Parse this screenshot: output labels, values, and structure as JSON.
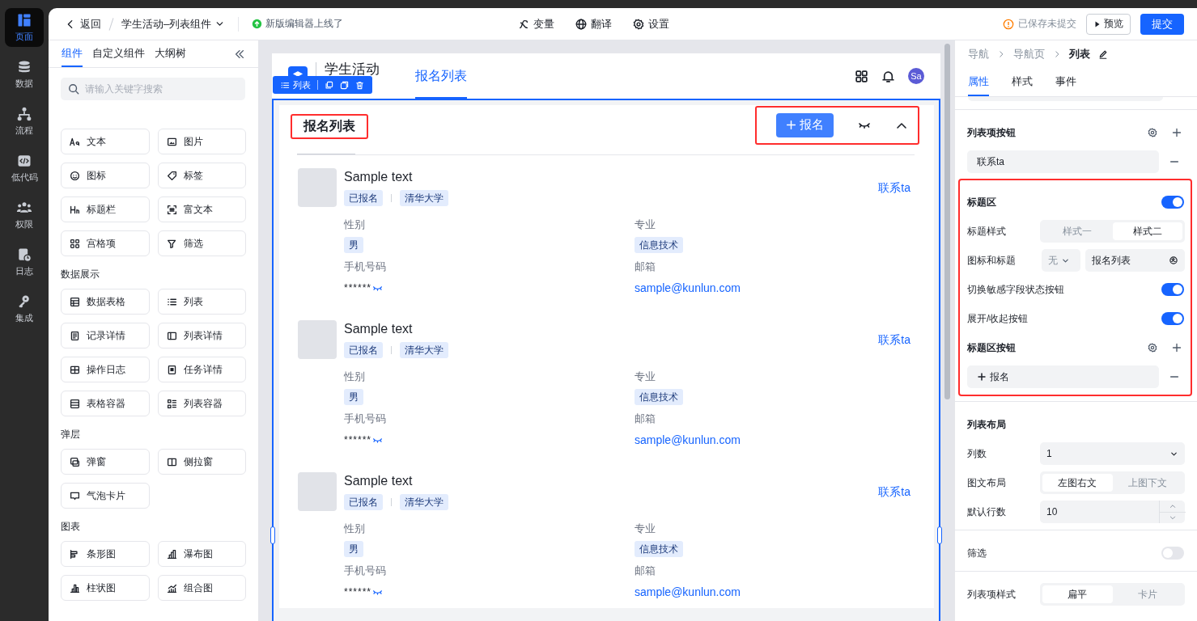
{
  "rail": {
    "items": [
      {
        "label": "页面",
        "selected": true
      },
      {
        "label": "数据",
        "selected": false
      },
      {
        "label": "流程",
        "selected": false
      },
      {
        "label": "低代码",
        "selected": false
      },
      {
        "label": "权限",
        "selected": false
      },
      {
        "label": "日志",
        "selected": false
      },
      {
        "label": "集成",
        "selected": false
      }
    ]
  },
  "topbar": {
    "back": "返回",
    "title": "学生活动–列表组件",
    "notice": "新版编辑器上线了",
    "tools": [
      {
        "label": "变量"
      },
      {
        "label": "翻译"
      },
      {
        "label": "设置"
      }
    ],
    "status": "已保存未提交",
    "preview": "预览",
    "submit": "提交"
  },
  "left_panel": {
    "tabs": [
      {
        "label": "组件",
        "selected": true
      },
      {
        "label": "自定义组件",
        "selected": false
      },
      {
        "label": "大纲树",
        "selected": false
      }
    ],
    "search": {
      "placeholder": "请输入关键字搜索"
    },
    "sections": [
      {
        "items": [
          "文本",
          "图片",
          "图标",
          "标签",
          "标题栏",
          "富文本",
          "宫格项",
          "筛选"
        ]
      },
      {
        "title": "数据展示",
        "items": [
          "数据表格",
          "列表",
          "记录详情",
          "列表详情",
          "操作日志",
          "任务详情",
          "表格容器",
          "列表容器"
        ]
      },
      {
        "title": "弹层",
        "items": [
          "弹窗",
          "侧拉窗",
          "气泡卡片"
        ]
      },
      {
        "title": "图表",
        "items": [
          "条形图",
          "瀑布图",
          "柱状图",
          "组合图"
        ]
      }
    ]
  },
  "canvas": {
    "app_name": "学生活动",
    "nav_tab": {
      "label": "报名列表",
      "selected": true
    },
    "avatar": "Sa",
    "toolbar_label": "列表",
    "list": {
      "title": "报名列表",
      "add_button": "报名",
      "items": [
        {
          "title": "Sample text",
          "tags": [
            "已报名",
            "清华大学"
          ],
          "action": "联系ta",
          "fields": [
            {
              "label": "性别",
              "value": "男",
              "kind": "tag"
            },
            {
              "label": "专业",
              "value": "信息技术",
              "kind": "tag"
            },
            {
              "label": "手机号码",
              "value": "******",
              "kind": "masked"
            },
            {
              "label": "邮箱",
              "value": "sample@kunlun.com",
              "kind": "link"
            }
          ]
        },
        {
          "title": "Sample text",
          "tags": [
            "已报名",
            "清华大学"
          ],
          "action": "联系ta",
          "fields": [
            {
              "label": "性别",
              "value": "男",
              "kind": "tag"
            },
            {
              "label": "专业",
              "value": "信息技术",
              "kind": "tag"
            },
            {
              "label": "手机号码",
              "value": "******",
              "kind": "masked"
            },
            {
              "label": "邮箱",
              "value": "sample@kunlun.com",
              "kind": "link"
            }
          ]
        },
        {
          "title": "Sample text",
          "tags": [
            "已报名",
            "清华大学"
          ],
          "action": "联系ta",
          "fields": [
            {
              "label": "性别",
              "value": "男",
              "kind": "tag"
            },
            {
              "label": "专业",
              "value": "信息技术",
              "kind": "tag"
            },
            {
              "label": "手机号码",
              "value": "******",
              "kind": "masked"
            },
            {
              "label": "邮箱",
              "value": "sample@kunlun.com",
              "kind": "link"
            }
          ]
        }
      ]
    }
  },
  "right_panel": {
    "breadcrumb": [
      "导航",
      "导航页",
      "列表"
    ],
    "tabs": [
      {
        "label": "属性",
        "selected": true
      },
      {
        "label": "样式",
        "selected": false
      },
      {
        "label": "事件",
        "selected": false
      }
    ],
    "sections": [
      {
        "highlighted": false,
        "rows": [
          {
            "kind": "heading_tools",
            "label": "列表项按钮"
          },
          {
            "kind": "item",
            "value": "联系ta",
            "plus": false
          }
        ]
      },
      {
        "highlighted": true,
        "rows": [
          {
            "kind": "toggle",
            "label": "标题区",
            "on": true
          },
          {
            "kind": "segmented",
            "label": "标题样式",
            "options": [
              {
                "label": "样式一",
                "selected": false
              },
              {
                "label": "样式二",
                "selected": true
              }
            ]
          },
          {
            "kind": "icon_title",
            "label": "图标和标题",
            "select": "无",
            "value": "报名列表"
          },
          {
            "kind": "toggle",
            "label": "切换敏感字段状态按钮",
            "on": true
          },
          {
            "kind": "toggle",
            "label": "展开/收起按钮",
            "on": true
          },
          {
            "kind": "heading_tools",
            "label": "标题区按钮"
          },
          {
            "kind": "item",
            "value": "报名",
            "plus": true
          }
        ]
      },
      {
        "highlighted": false,
        "rows": [
          {
            "kind": "heading",
            "label": "列表布局"
          },
          {
            "kind": "select",
            "label": "列数",
            "value": "1"
          },
          {
            "kind": "segmented",
            "label": "图文布局",
            "options": [
              {
                "label": "左图右文",
                "selected": true
              },
              {
                "label": "上图下文",
                "selected": false
              }
            ]
          },
          {
            "kind": "number",
            "label": "默认行数",
            "value": "10"
          }
        ]
      },
      {
        "highlighted": false,
        "rows": [
          {
            "kind": "toggle",
            "label": "筛选",
            "on": false
          }
        ]
      },
      {
        "highlighted": false,
        "rows": [
          {
            "kind": "segmented",
            "label": "列表项样式",
            "options": [
              {
                "label": "扁平",
                "selected": true
              },
              {
                "label": "卡片",
                "selected": false
              }
            ]
          }
        ]
      }
    ]
  }
}
